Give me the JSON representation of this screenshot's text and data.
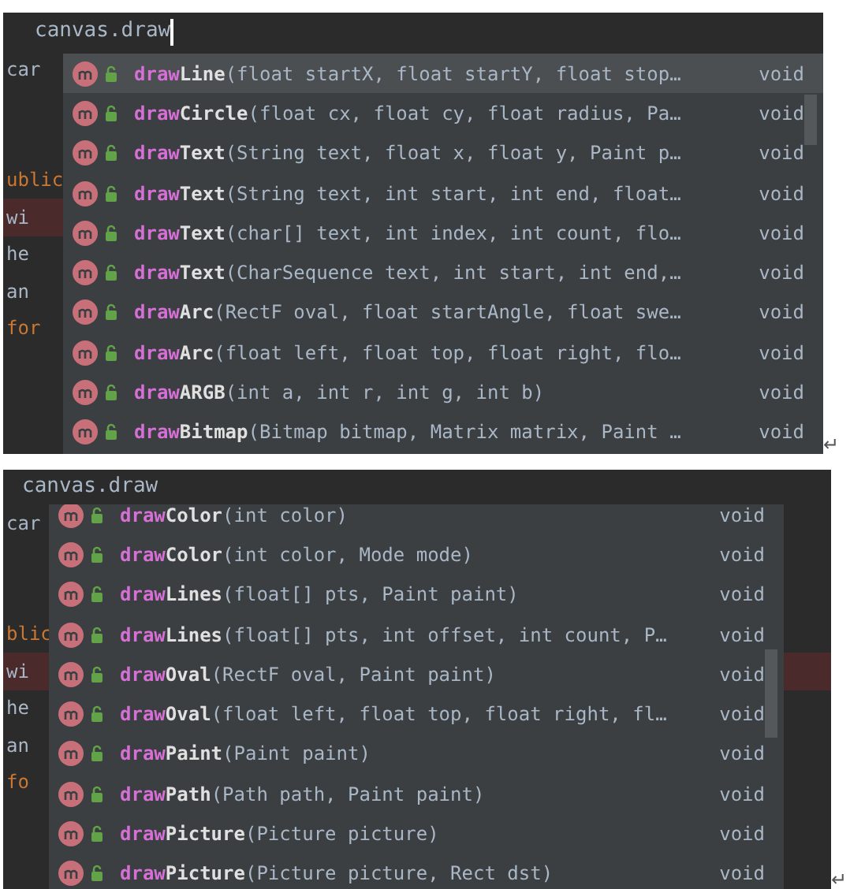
{
  "panels": [
    {
      "editor": {
        "typed_line": "canvas.draw",
        "cursor": true,
        "lines": [
          {
            "text": "car",
            "kind": "plain",
            "highlighted": false
          },
          {
            "kind": "hidden"
          },
          {
            "kind": "hidden"
          },
          {
            "text": "ublic",
            "kind": "keyword",
            "highlighted": false
          },
          {
            "text": "wi",
            "kind": "plain",
            "highlighted": true
          },
          {
            "text": "he",
            "kind": "plain",
            "highlighted": false
          },
          {
            "text": "an",
            "kind": "plain",
            "highlighted": false
          },
          {
            "text": "for",
            "kind": "keyword",
            "highlighted": false
          }
        ]
      },
      "popup": {
        "clipped_top": false,
        "items": [
          {
            "prefix": "draw",
            "name": "Line",
            "params": "(float startX, float startY, float stop…",
            "return_type": "void",
            "selected": true
          },
          {
            "prefix": "draw",
            "name": "Circle",
            "params": "(float cx, float cy, float radius, Pa…",
            "return_type": "void",
            "selected": false
          },
          {
            "prefix": "draw",
            "name": "Text",
            "params": "(String text, float x, float y, Paint p…",
            "return_type": "void",
            "selected": false
          },
          {
            "prefix": "draw",
            "name": "Text",
            "params": "(String text, int start, int end, float…",
            "return_type": "void",
            "selected": false
          },
          {
            "prefix": "draw",
            "name": "Text",
            "params": "(char[] text, int index, int count, flo…",
            "return_type": "void",
            "selected": false
          },
          {
            "prefix": "draw",
            "name": "Text",
            "params": "(CharSequence text, int start, int end,…",
            "return_type": "void",
            "selected": false
          },
          {
            "prefix": "draw",
            "name": "Arc",
            "params": "(RectF oval, float startAngle, float swe…",
            "return_type": "void",
            "selected": false
          },
          {
            "prefix": "draw",
            "name": "Arc",
            "params": "(float left, float top, float right, flo…",
            "return_type": "void",
            "selected": false
          },
          {
            "prefix": "draw",
            "name": "ARGB",
            "params": "(int a, int r, int g, int b)",
            "return_type": "void",
            "selected": false
          },
          {
            "prefix": "draw",
            "name": "Bitmap",
            "params": "(Bitmap bitmap, Matrix matrix, Paint …",
            "return_type": "void",
            "selected": false
          }
        ]
      },
      "return_mark": "↵"
    },
    {
      "editor": {
        "typed_line": "canvas.draw",
        "cursor": false,
        "lines": [
          {
            "text": "car",
            "kind": "plain",
            "highlighted": false
          },
          {
            "kind": "hidden"
          },
          {
            "kind": "hidden"
          },
          {
            "text": "blic",
            "kind": "keyword",
            "highlighted": false
          },
          {
            "text": "wi",
            "kind": "plain",
            "highlighted": true
          },
          {
            "text": "he",
            "kind": "plain",
            "highlighted": false
          },
          {
            "text": "an",
            "kind": "plain",
            "highlighted": false
          },
          {
            "text": "fo",
            "kind": "keyword",
            "highlighted": false
          }
        ]
      },
      "popup": {
        "clipped_top": true,
        "items": [
          {
            "prefix": "draw",
            "name": "Color",
            "params": "(int color)",
            "return_type": "void",
            "selected": false
          },
          {
            "prefix": "draw",
            "name": "Color",
            "params": "(int color, Mode mode)",
            "return_type": "void",
            "selected": false
          },
          {
            "prefix": "draw",
            "name": "Lines",
            "params": "(float[] pts, Paint paint)",
            "return_type": "void",
            "selected": false
          },
          {
            "prefix": "draw",
            "name": "Lines",
            "params": "(float[] pts, int offset, int count, P…",
            "return_type": "void",
            "selected": false
          },
          {
            "prefix": "draw",
            "name": "Oval",
            "params": "(RectF oval, Paint paint)",
            "return_type": "void",
            "selected": false
          },
          {
            "prefix": "draw",
            "name": "Oval",
            "params": "(float left, float top, float right, fl…",
            "return_type": "void",
            "selected": false
          },
          {
            "prefix": "draw",
            "name": "Paint",
            "params": "(Paint paint)",
            "return_type": "void",
            "selected": false
          },
          {
            "prefix": "draw",
            "name": "Path",
            "params": "(Path path, Paint paint)",
            "return_type": "void",
            "selected": false
          },
          {
            "prefix": "draw",
            "name": "Picture",
            "params": "(Picture picture)",
            "return_type": "void",
            "selected": false
          },
          {
            "prefix": "draw",
            "name": "Picture",
            "params": "(Picture picture, Rect dst)",
            "return_type": "void",
            "selected": false
          }
        ]
      },
      "return_mark": "↵"
    }
  ]
}
